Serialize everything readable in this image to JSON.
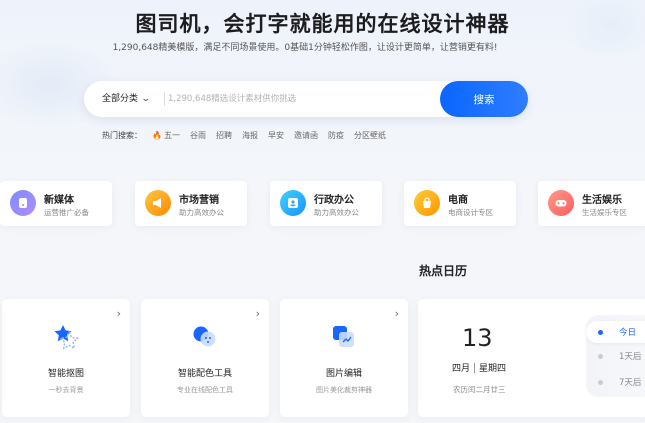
{
  "hero": {
    "title": "图司机，会打字就能用的在线设计神器",
    "subtitle": "1,290,648精美模版，满足不同场景使用。0基础1分钟轻松作图，让设计更简单，让营销更有料!"
  },
  "search": {
    "category": "全部分类",
    "placeholder": "1,290,648精选设计素材供你挑选",
    "button": "搜索"
  },
  "hot": {
    "label": "热门搜索：",
    "items": [
      "五一",
      "谷雨",
      "招聘",
      "海报",
      "早安",
      "邀请函",
      "防疫",
      "分区壁纸"
    ]
  },
  "categories": [
    {
      "title": "新媒体",
      "sub": "运营推广必备",
      "color_a": "#7e8cff",
      "color_b": "#b08cff"
    },
    {
      "title": "市场营销",
      "sub": "助力高效办公",
      "color_a": "#ffb020",
      "color_b": "#ff8a00"
    },
    {
      "title": "行政办公",
      "sub": "助力高效办公",
      "color_a": "#2fc4ff",
      "color_b": "#1a94ff"
    },
    {
      "title": "电商",
      "sub": "电商设计专区",
      "color_a": "#ffbf2a",
      "color_b": "#ff9500"
    },
    {
      "title": "生活娱乐",
      "sub": "生活娱乐专区",
      "color_a": "#ff8a7a",
      "color_b": "#ff5c5c"
    }
  ],
  "tools": [
    {
      "title": "智能抠图",
      "sub": "一秒去背景"
    },
    {
      "title": "智能配色工具",
      "sub": "专业在线配色工具"
    },
    {
      "title": "图片编辑",
      "sub": "图片美化裁剪神器"
    }
  ],
  "calendar": {
    "section_title": "热点日历",
    "day": "13",
    "month": "四月",
    "weekday": "星期四",
    "lunar": "农历闰二月廿三",
    "tabs": [
      "今日",
      "1天后",
      "7天后"
    ]
  },
  "colors": {
    "accent": "#1766ff",
    "search_button": "#0a66ff"
  }
}
